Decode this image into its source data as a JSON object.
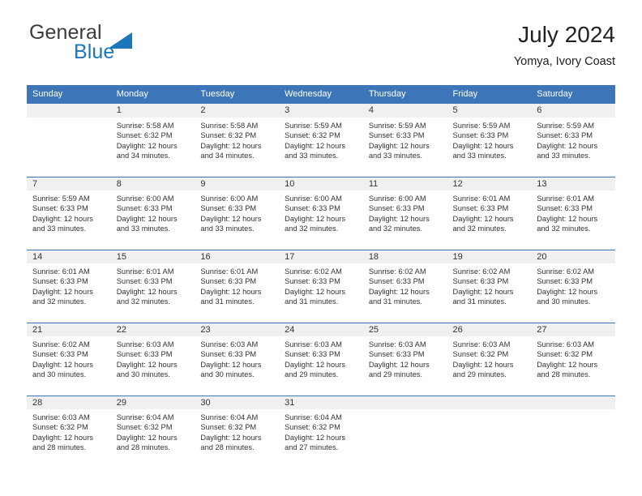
{
  "brand": {
    "word1": "General",
    "word2": "Blue",
    "triangle_color": "#1b76bc"
  },
  "header": {
    "title": "July 2024",
    "subtitle": "Yomya, Ivory Coast"
  },
  "theme": {
    "header_blue": "#3d76b8",
    "daynum_bg": "#f0f0f0",
    "text": "#333333"
  },
  "columns": [
    "Sunday",
    "Monday",
    "Tuesday",
    "Wednesday",
    "Thursday",
    "Friday",
    "Saturday"
  ],
  "weeks": [
    [
      {
        "day": "",
        "empty": true,
        "sunrise": "",
        "sunset": "",
        "daylight1": "",
        "daylight2": ""
      },
      {
        "day": "1",
        "sunrise": "Sunrise: 5:58 AM",
        "sunset": "Sunset: 6:32 PM",
        "daylight1": "Daylight: 12 hours",
        "daylight2": "and 34 minutes."
      },
      {
        "day": "2",
        "sunrise": "Sunrise: 5:58 AM",
        "sunset": "Sunset: 6:32 PM",
        "daylight1": "Daylight: 12 hours",
        "daylight2": "and 34 minutes."
      },
      {
        "day": "3",
        "sunrise": "Sunrise: 5:59 AM",
        "sunset": "Sunset: 6:32 PM",
        "daylight1": "Daylight: 12 hours",
        "daylight2": "and 33 minutes."
      },
      {
        "day": "4",
        "sunrise": "Sunrise: 5:59 AM",
        "sunset": "Sunset: 6:33 PM",
        "daylight1": "Daylight: 12 hours",
        "daylight2": "and 33 minutes."
      },
      {
        "day": "5",
        "sunrise": "Sunrise: 5:59 AM",
        "sunset": "Sunset: 6:33 PM",
        "daylight1": "Daylight: 12 hours",
        "daylight2": "and 33 minutes."
      },
      {
        "day": "6",
        "sunrise": "Sunrise: 5:59 AM",
        "sunset": "Sunset: 6:33 PM",
        "daylight1": "Daylight: 12 hours",
        "daylight2": "and 33 minutes."
      }
    ],
    [
      {
        "day": "7",
        "sunrise": "Sunrise: 5:59 AM",
        "sunset": "Sunset: 6:33 PM",
        "daylight1": "Daylight: 12 hours",
        "daylight2": "and 33 minutes."
      },
      {
        "day": "8",
        "sunrise": "Sunrise: 6:00 AM",
        "sunset": "Sunset: 6:33 PM",
        "daylight1": "Daylight: 12 hours",
        "daylight2": "and 33 minutes."
      },
      {
        "day": "9",
        "sunrise": "Sunrise: 6:00 AM",
        "sunset": "Sunset: 6:33 PM",
        "daylight1": "Daylight: 12 hours",
        "daylight2": "and 33 minutes."
      },
      {
        "day": "10",
        "sunrise": "Sunrise: 6:00 AM",
        "sunset": "Sunset: 6:33 PM",
        "daylight1": "Daylight: 12 hours",
        "daylight2": "and 32 minutes."
      },
      {
        "day": "11",
        "sunrise": "Sunrise: 6:00 AM",
        "sunset": "Sunset: 6:33 PM",
        "daylight1": "Daylight: 12 hours",
        "daylight2": "and 32 minutes."
      },
      {
        "day": "12",
        "sunrise": "Sunrise: 6:01 AM",
        "sunset": "Sunset: 6:33 PM",
        "daylight1": "Daylight: 12 hours",
        "daylight2": "and 32 minutes."
      },
      {
        "day": "13",
        "sunrise": "Sunrise: 6:01 AM",
        "sunset": "Sunset: 6:33 PM",
        "daylight1": "Daylight: 12 hours",
        "daylight2": "and 32 minutes."
      }
    ],
    [
      {
        "day": "14",
        "sunrise": "Sunrise: 6:01 AM",
        "sunset": "Sunset: 6:33 PM",
        "daylight1": "Daylight: 12 hours",
        "daylight2": "and 32 minutes."
      },
      {
        "day": "15",
        "sunrise": "Sunrise: 6:01 AM",
        "sunset": "Sunset: 6:33 PM",
        "daylight1": "Daylight: 12 hours",
        "daylight2": "and 32 minutes."
      },
      {
        "day": "16",
        "sunrise": "Sunrise: 6:01 AM",
        "sunset": "Sunset: 6:33 PM",
        "daylight1": "Daylight: 12 hours",
        "daylight2": "and 31 minutes."
      },
      {
        "day": "17",
        "sunrise": "Sunrise: 6:02 AM",
        "sunset": "Sunset: 6:33 PM",
        "daylight1": "Daylight: 12 hours",
        "daylight2": "and 31 minutes."
      },
      {
        "day": "18",
        "sunrise": "Sunrise: 6:02 AM",
        "sunset": "Sunset: 6:33 PM",
        "daylight1": "Daylight: 12 hours",
        "daylight2": "and 31 minutes."
      },
      {
        "day": "19",
        "sunrise": "Sunrise: 6:02 AM",
        "sunset": "Sunset: 6:33 PM",
        "daylight1": "Daylight: 12 hours",
        "daylight2": "and 31 minutes."
      },
      {
        "day": "20",
        "sunrise": "Sunrise: 6:02 AM",
        "sunset": "Sunset: 6:33 PM",
        "daylight1": "Daylight: 12 hours",
        "daylight2": "and 30 minutes."
      }
    ],
    [
      {
        "day": "21",
        "sunrise": "Sunrise: 6:02 AM",
        "sunset": "Sunset: 6:33 PM",
        "daylight1": "Daylight: 12 hours",
        "daylight2": "and 30 minutes."
      },
      {
        "day": "22",
        "sunrise": "Sunrise: 6:03 AM",
        "sunset": "Sunset: 6:33 PM",
        "daylight1": "Daylight: 12 hours",
        "daylight2": "and 30 minutes."
      },
      {
        "day": "23",
        "sunrise": "Sunrise: 6:03 AM",
        "sunset": "Sunset: 6:33 PM",
        "daylight1": "Daylight: 12 hours",
        "daylight2": "and 30 minutes."
      },
      {
        "day": "24",
        "sunrise": "Sunrise: 6:03 AM",
        "sunset": "Sunset: 6:33 PM",
        "daylight1": "Daylight: 12 hours",
        "daylight2": "and 29 minutes."
      },
      {
        "day": "25",
        "sunrise": "Sunrise: 6:03 AM",
        "sunset": "Sunset: 6:33 PM",
        "daylight1": "Daylight: 12 hours",
        "daylight2": "and 29 minutes."
      },
      {
        "day": "26",
        "sunrise": "Sunrise: 6:03 AM",
        "sunset": "Sunset: 6:32 PM",
        "daylight1": "Daylight: 12 hours",
        "daylight2": "and 29 minutes."
      },
      {
        "day": "27",
        "sunrise": "Sunrise: 6:03 AM",
        "sunset": "Sunset: 6:32 PM",
        "daylight1": "Daylight: 12 hours",
        "daylight2": "and 28 minutes."
      }
    ],
    [
      {
        "day": "28",
        "sunrise": "Sunrise: 6:03 AM",
        "sunset": "Sunset: 6:32 PM",
        "daylight1": "Daylight: 12 hours",
        "daylight2": "and 28 minutes."
      },
      {
        "day": "29",
        "sunrise": "Sunrise: 6:04 AM",
        "sunset": "Sunset: 6:32 PM",
        "daylight1": "Daylight: 12 hours",
        "daylight2": "and 28 minutes."
      },
      {
        "day": "30",
        "sunrise": "Sunrise: 6:04 AM",
        "sunset": "Sunset: 6:32 PM",
        "daylight1": "Daylight: 12 hours",
        "daylight2": "and 28 minutes."
      },
      {
        "day": "31",
        "sunrise": "Sunrise: 6:04 AM",
        "sunset": "Sunset: 6:32 PM",
        "daylight1": "Daylight: 12 hours",
        "daylight2": "and 27 minutes."
      },
      {
        "day": "",
        "empty": true,
        "sunrise": "",
        "sunset": "",
        "daylight1": "",
        "daylight2": ""
      },
      {
        "day": "",
        "empty": true,
        "sunrise": "",
        "sunset": "",
        "daylight1": "",
        "daylight2": ""
      },
      {
        "day": "",
        "empty": true,
        "sunrise": "",
        "sunset": "",
        "daylight1": "",
        "daylight2": ""
      }
    ]
  ]
}
